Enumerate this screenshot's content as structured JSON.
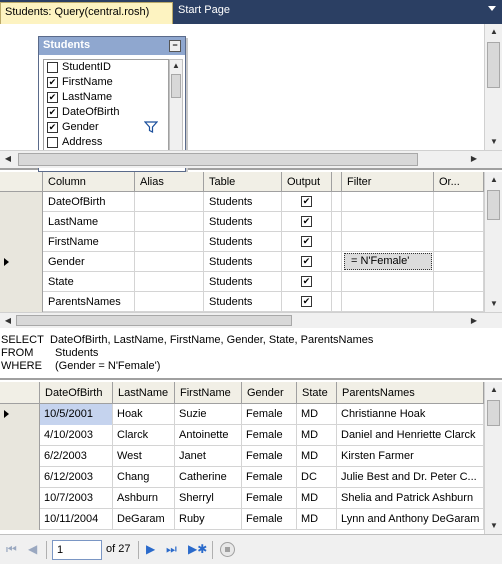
{
  "tabs": {
    "active": "Students: Query(central.rosh)",
    "inactive": "Start Page"
  },
  "diagram": {
    "table_title": "Students",
    "table_min": "−",
    "fields": [
      {
        "name": "StudentID",
        "checked": false
      },
      {
        "name": "FirstName",
        "checked": true
      },
      {
        "name": "LastName",
        "checked": true
      },
      {
        "name": "DateOfBirth",
        "checked": true
      },
      {
        "name": "Gender",
        "checked": true,
        "filter": true
      },
      {
        "name": "Address",
        "checked": false
      }
    ]
  },
  "criteria": {
    "headers": [
      "Column",
      "Alias",
      "Table",
      "Output",
      "Filter",
      "Or..."
    ],
    "rows": [
      {
        "column": "DateOfBirth",
        "alias": "",
        "table": "Students",
        "output": true,
        "filter": ""
      },
      {
        "column": "LastName",
        "alias": "",
        "table": "Students",
        "output": true,
        "filter": ""
      },
      {
        "column": "FirstName",
        "alias": "",
        "table": "Students",
        "output": true,
        "filter": ""
      },
      {
        "column": "Gender",
        "alias": "",
        "table": "Students",
        "output": true,
        "filter": "= N'Female'"
      },
      {
        "column": "State",
        "alias": "",
        "table": "Students",
        "output": true,
        "filter": ""
      },
      {
        "column": "ParentsNames",
        "alias": "",
        "table": "Students",
        "output": true,
        "filter": ""
      }
    ]
  },
  "sql": [
    {
      "keyword": "SELECT",
      "body": "DateOfBirth, LastName, FirstName, Gender, State, ParentsNames"
    },
    {
      "keyword": "FROM",
      "body": "Students"
    },
    {
      "keyword": "WHERE",
      "body": "(Gender = N'Female')"
    }
  ],
  "results": {
    "headers": [
      "DateOfBirth",
      "LastName",
      "FirstName",
      "Gender",
      "State",
      "ParentsNames"
    ],
    "rows": [
      [
        "10/5/2001",
        "Hoak",
        "Suzie",
        "Female",
        "MD",
        "Christianne Hoak"
      ],
      [
        "4/10/2003",
        "Clarck",
        "Antoinette",
        "Female",
        "MD",
        "Daniel and Henriette Clarck"
      ],
      [
        "6/2/2003",
        "West",
        "Janet",
        "Female",
        "MD",
        "Kirsten Farmer"
      ],
      [
        "6/12/2003",
        "Chang",
        "Catherine",
        "Female",
        "DC",
        "Julie Best and Dr. Peter C..."
      ],
      [
        "10/7/2003",
        "Ashburn",
        "Sherryl",
        "Female",
        "MD",
        "Shelia and Patrick Ashburn"
      ],
      [
        "10/11/2004",
        "DeGaram",
        "Ruby",
        "Female",
        "MD",
        "Lynn and Anthony DeGaram"
      ]
    ]
  },
  "navigator": {
    "current_page": "1",
    "of_label": "of 27"
  },
  "icons": {
    "first": "first-record-icon",
    "prev": "previous-record-icon",
    "next": "next-record-icon",
    "last": "last-record-icon",
    "new": "new-record-icon",
    "stop": "stop-icon"
  }
}
